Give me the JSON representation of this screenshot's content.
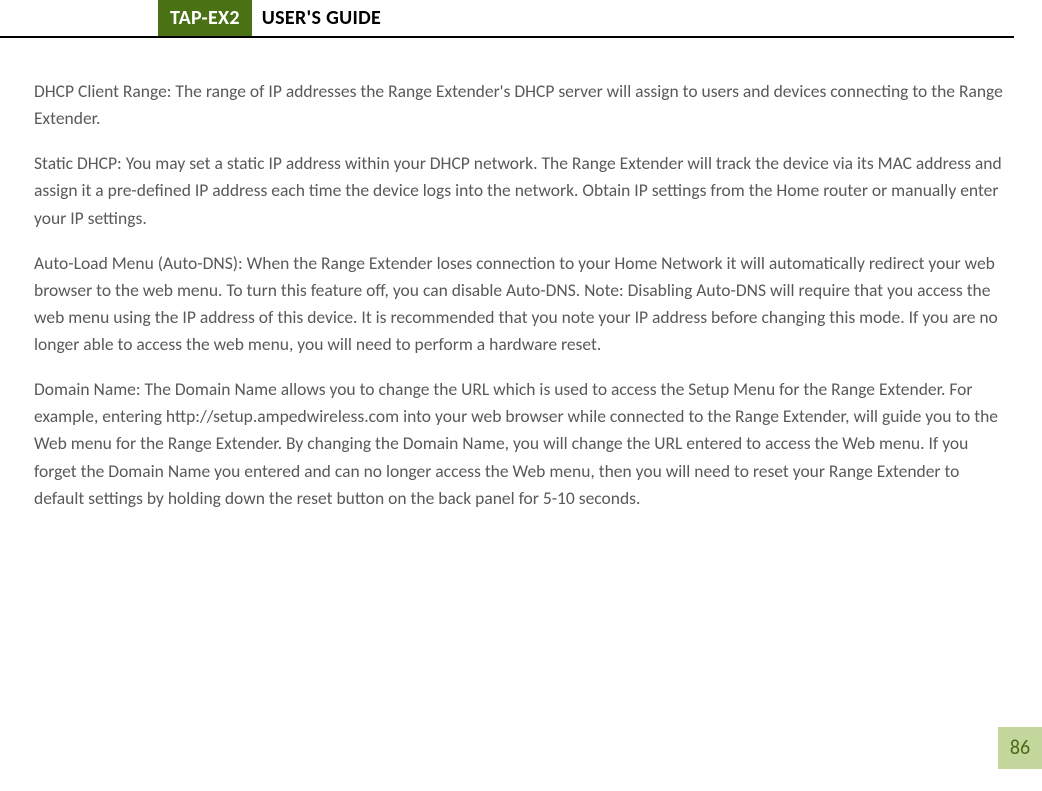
{
  "header": {
    "badge": "TAP-EX2",
    "title": "USER'S GUIDE"
  },
  "paragraphs": {
    "p1": "DHCP Client Range: The range of IP addresses the Range Extender's DHCP server will assign to users and devices connecting to the Range Extender.",
    "p2": "Static DHCP: You may set a static IP address within your DHCP network. The Range Extender will track the device via its MAC address and assign it a pre-defined IP address each time the device logs into the network. Obtain IP settings from the Home router or manually enter your IP settings.",
    "p3": "Auto-Load Menu (Auto-DNS): When the Range Extender loses connection to your Home Network it will automatically redirect your web browser to the web menu. To turn this feature off, you can disable Auto-DNS. Note: Disabling Auto-DNS will require that you access the web menu using the IP address of this device. It is recommended that you note your IP address before changing this mode. If you are no longer able to access the web menu, you will need to perform a hardware reset.",
    "p4": "Domain Name: The Domain Name allows you to change the URL which is used to access the Setup Menu for the Range Extender. For example, entering http://setup.ampedwireless.com into your web browser while connected to the Range Extender, will guide you to the Web menu for the Range Extender. By changing the Domain Name, you will change the URL entered to access the Web menu. If you forget the Domain Name you entered and can no longer access the Web menu, then you will need to reset your Range Extender to default settings by holding down the reset button on the back panel for 5-10 seconds."
  },
  "page_number": "86"
}
